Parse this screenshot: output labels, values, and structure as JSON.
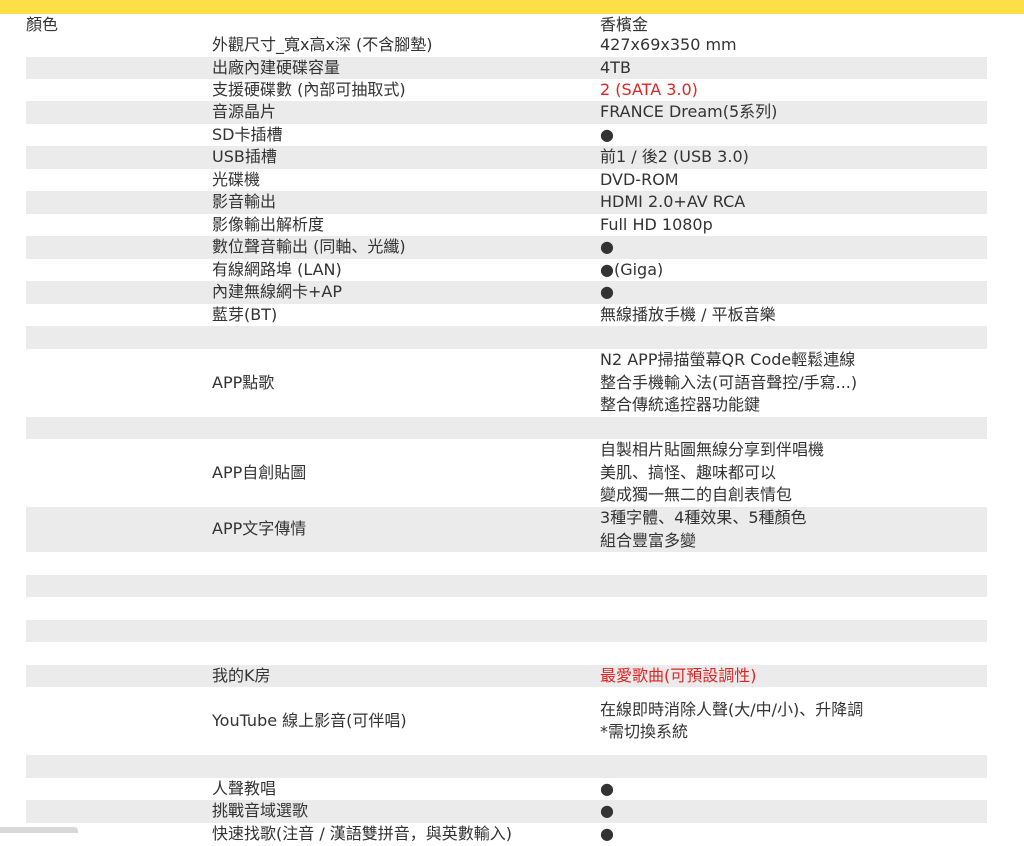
{
  "rows": [
    {
      "label": "顏色",
      "name": "",
      "value": [
        "香檳金"
      ],
      "shade": false,
      "h": 20,
      "whitebox": true
    },
    {
      "label": "",
      "name": "外觀尺寸_寬x高x深 (不含腳墊)",
      "value": [
        "427x69x350 mm"
      ],
      "shade": false,
      "h": 23
    },
    {
      "label": "",
      "name": "出廠內建硬碟容量",
      "value": [
        "4TB"
      ],
      "shade": true,
      "h": 22
    },
    {
      "label": "",
      "name": "支援硬碟數 (內部可抽取式)",
      "value": [
        "2 (SATA 3.0)"
      ],
      "shade": false,
      "h": 22,
      "red": true
    },
    {
      "label": "",
      "name": "音源晶片",
      "value": [
        "FRANCE Dream(5系列)"
      ],
      "shade": true,
      "h": 23
    },
    {
      "label": "",
      "name": "SD卡插槽",
      "value": [
        "●"
      ],
      "shade": false,
      "h": 22
    },
    {
      "label": "",
      "name": "USB插槽",
      "value": [
        "前1 / 後2 (USB 3.0)"
      ],
      "shade": true,
      "h": 23
    },
    {
      "label": "",
      "name": "光碟機",
      "value": [
        "DVD-ROM"
      ],
      "shade": false,
      "h": 22
    },
    {
      "label": "",
      "name": "影音輸出",
      "value": [
        "HDMI 2.0+AV RCA"
      ],
      "shade": true,
      "h": 23
    },
    {
      "label": "",
      "name": "影像輸出解析度",
      "value": [
        "Full HD 1080p"
      ],
      "shade": false,
      "h": 22
    },
    {
      "label": "",
      "name": "數位聲音輸出 (同軸、光纖)",
      "value": [
        "●"
      ],
      "shade": true,
      "h": 23
    },
    {
      "label": "",
      "name": "有線網路埠 (LAN)",
      "value": [
        "●(Giga)"
      ],
      "shade": false,
      "h": 22
    },
    {
      "label": "",
      "name": "內建無線網卡+AP",
      "value": [
        "●"
      ],
      "shade": true,
      "h": 23
    },
    {
      "label": "",
      "name": "藍芽(BT)",
      "value": [
        "無線播放手機 / 平板音樂"
      ],
      "shade": false,
      "h": 22
    },
    {
      "label": "",
      "name": "",
      "value": [],
      "shade": true,
      "h": 23
    },
    {
      "label": "",
      "name": "APP點歌",
      "value": [
        "N2 APP掃描螢幕QR Code輕鬆連線",
        "整合手機輸入法(可語音聲控/手寫...)",
        "整合傳統遙控器功能鍵"
      ],
      "shade": false,
      "h": 68
    },
    {
      "label": "",
      "name": "",
      "value": [],
      "shade": true,
      "h": 22
    },
    {
      "label": "",
      "name": "APP自創貼圖",
      "value": [
        "自製相片貼圖無線分享到伴唱機",
        "美肌、搞怪、趣味都可以",
        "變成獨一無二的自創表情包"
      ],
      "shade": false,
      "h": 68
    },
    {
      "label": "",
      "name": "APP文字傳情",
      "value": [
        "3種字體、4種效果、5種顏色",
        "組合豐富多變"
      ],
      "shade": true,
      "h": 45
    },
    {
      "label": "",
      "name": "",
      "value": [],
      "shade": false,
      "h": 23
    },
    {
      "label": "",
      "name": "",
      "value": [],
      "shade": true,
      "h": 22
    },
    {
      "label": "",
      "name": "",
      "value": [],
      "shade": false,
      "h": 23
    },
    {
      "label": "",
      "name": "",
      "value": [],
      "shade": true,
      "h": 22
    },
    {
      "label": "",
      "name": "",
      "value": [],
      "shade": false,
      "h": 23
    },
    {
      "label": "",
      "name": "我的K房",
      "value": [
        "最愛歌曲(可預設調性)"
      ],
      "shade": true,
      "h": 22,
      "red": true
    },
    {
      "label": "",
      "name": "YouTube 線上影音(可伴唱)",
      "value": [
        "在線即時消除人聲(大/中/小)、升降調",
        "*需切換系統"
      ],
      "shade": false,
      "h": 68
    },
    {
      "label": "",
      "name": "",
      "value": [],
      "shade": true,
      "h": 23
    },
    {
      "label": "",
      "name": "人聲教唱",
      "value": [
        "●"
      ],
      "shade": false,
      "h": 22
    },
    {
      "label": "",
      "name": "挑戰音域選歌",
      "value": [
        "●"
      ],
      "shade": true,
      "h": 23
    },
    {
      "label": "",
      "name": "快速找歌(注音 / 漢語雙拼音，與英數輸入)",
      "value": [
        "●"
      ],
      "shade": false,
      "h": 22
    }
  ]
}
